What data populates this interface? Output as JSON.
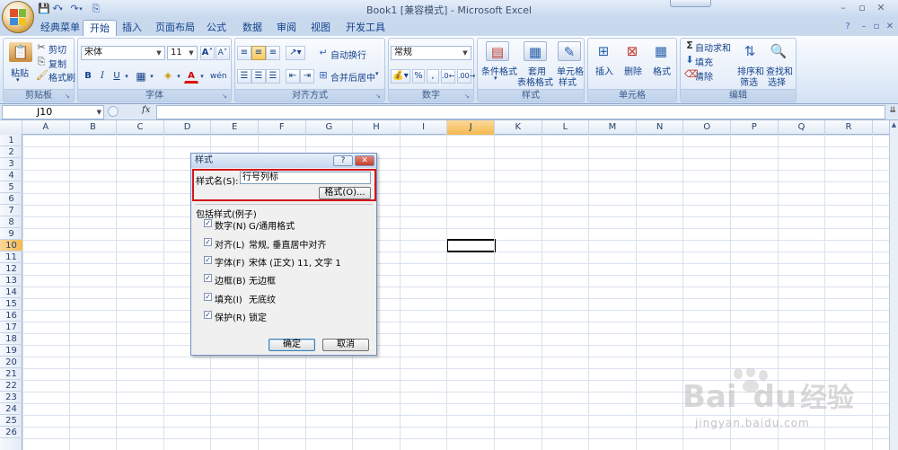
{
  "title_bar": {
    "title": "Book1  [兼容模式] - Microsoft Excel",
    "quick_access": [
      "save-icon",
      "undo-icon",
      "redo-icon",
      "customize-icon"
    ]
  },
  "ribbon": {
    "tabs": [
      {
        "label": "经典菜单"
      },
      {
        "label": "开始",
        "active": true
      },
      {
        "label": "插入"
      },
      {
        "label": "页面布局"
      },
      {
        "label": "公式"
      },
      {
        "label": "数据"
      },
      {
        "label": "审阅"
      },
      {
        "label": "视图"
      },
      {
        "label": "开发工具"
      }
    ],
    "clipboard": {
      "label": "剪贴板",
      "paste": "粘贴",
      "cut": "剪切",
      "copy": "复制",
      "format_painter": "格式刷"
    },
    "font": {
      "label": "字体",
      "font_name": "宋体",
      "font_size": "11",
      "bold": "B",
      "italic": "I",
      "underline": "U"
    },
    "alignment": {
      "label": "对齐方式",
      "wrap_text": "自动换行",
      "merge_center": "合并后居中"
    },
    "number": {
      "label": "数字",
      "format": "常规"
    },
    "styles": {
      "label": "样式",
      "conditional": "条件格式",
      "table_format": "套用",
      "table_format2": "表格格式",
      "cell_styles": "单元格",
      "cell_styles2": "样式"
    },
    "cells": {
      "label": "单元格",
      "insert": "插入",
      "delete": "删除",
      "format": "格式"
    },
    "editing": {
      "label": "编辑",
      "autosum": "自动求和",
      "fill": "填充",
      "clear": "清除",
      "sort": "排序和",
      "sort2": "筛选",
      "find": "查找和",
      "find2": "选择"
    }
  },
  "formula_bar": {
    "name_box": "J10",
    "fx": "fx",
    "formula": ""
  },
  "grid": {
    "columns": [
      "A",
      "B",
      "C",
      "D",
      "E",
      "F",
      "G",
      "H",
      "I",
      "J",
      "K",
      "L",
      "M",
      "N",
      "O",
      "P",
      "Q",
      "R"
    ],
    "rows": [
      "1",
      "2",
      "3",
      "4",
      "5",
      "6",
      "7",
      "8",
      "9",
      "10",
      "11",
      "12",
      "13",
      "14",
      "15",
      "16",
      "17",
      "18",
      "19",
      "20",
      "21",
      "22",
      "23",
      "24",
      "25",
      "26"
    ],
    "selected_column": "J",
    "selected_row": "10"
  },
  "dialog": {
    "title": "样式",
    "style_name_label": "样式名(S):",
    "style_name_value": "行号列标",
    "format_button": "格式(O)...",
    "includes_label": "包括样式(例子)",
    "items": [
      {
        "label": "数字(N)",
        "value": "G/通用格式",
        "checked": true
      },
      {
        "label": "对齐(L)",
        "value": "常规, 垂直居中对齐",
        "checked": true
      },
      {
        "label": "字体(F)",
        "value": "宋体 (正文) 11, 文字 1",
        "checked": true
      },
      {
        "label": "边框(B)",
        "value": "无边框",
        "checked": true
      },
      {
        "label": "填充(I)",
        "value": "无底纹",
        "checked": true
      },
      {
        "label": "保护(R)",
        "value": "锁定",
        "checked": true
      }
    ],
    "ok": "确定",
    "cancel": "取消"
  },
  "watermark": {
    "brand": "Bai",
    "brand2": "du",
    "cn": "经验",
    "url": "jingyan.baidu.com"
  }
}
